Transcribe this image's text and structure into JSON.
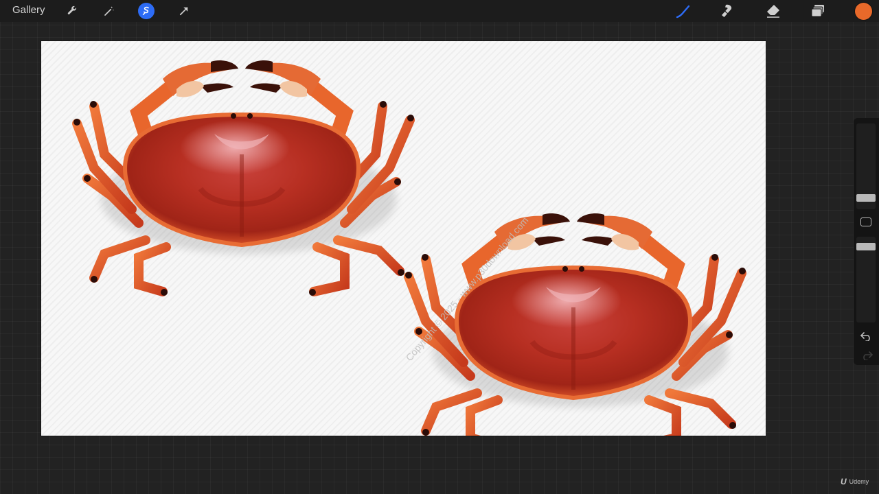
{
  "toolbar": {
    "gallery_label": "Gallery",
    "left_tools": [
      "wrench-icon",
      "magic-wand-icon",
      "selection-icon",
      "transform-arrow-icon"
    ],
    "active_left_tool": "selection-icon",
    "right_tools": [
      "brush-icon",
      "smudge-icon",
      "eraser-icon",
      "layers-icon"
    ],
    "active_right_tool": "brush-icon",
    "current_color": "#e8692a",
    "accent_color": "#2d6cf6"
  },
  "canvas": {
    "watermark": "Copyright © 2025 - www.p30download.com",
    "content": "two red crabs illustration"
  },
  "sidebar": {
    "icons": [
      "brush-size-slider",
      "modify-square-icon",
      "opacity-slider",
      "undo-icon",
      "redo-icon"
    ]
  },
  "branding": {
    "udemy_mark": "U",
    "udemy_label": "Udemy"
  }
}
